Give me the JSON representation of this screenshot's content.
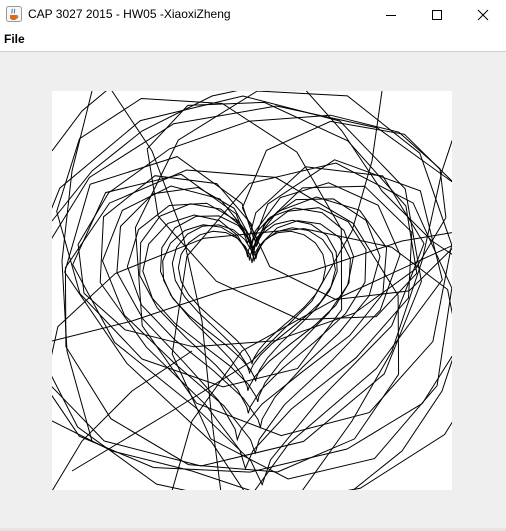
{
  "window": {
    "title": "CAP 3027 2015 - HW05 -XiaoxiZheng",
    "icon": "java-cup-icon",
    "controls": {
      "minimize_icon": "minimize-icon",
      "maximize_icon": "maximize-icon",
      "close_icon": "close-icon"
    }
  },
  "menubar": {
    "items": [
      {
        "label": "File"
      }
    ]
  },
  "canvas": {
    "background": "#ffffff",
    "stroke_color": "#000000"
  }
}
